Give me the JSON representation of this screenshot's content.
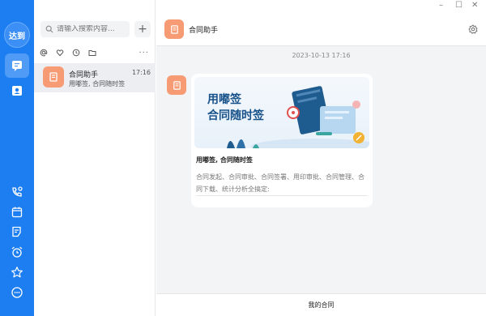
{
  "nav": {
    "avatar_label": "达到",
    "items": [
      {
        "icon": "chat-icon",
        "active": true
      },
      {
        "icon": "contacts-icon",
        "active": false
      }
    ],
    "bottom_items": [
      {
        "icon": "phone-icon"
      },
      {
        "icon": "calendar-icon"
      },
      {
        "icon": "notes-icon"
      },
      {
        "icon": "alarm-icon"
      },
      {
        "icon": "star-icon"
      },
      {
        "icon": "more-circle-icon"
      }
    ]
  },
  "list": {
    "search_placeholder": "请输入搜索内容...",
    "plus_label": "+",
    "filters": [
      "at-icon",
      "heart-icon",
      "clock-icon",
      "folder-icon"
    ],
    "more_label": "···",
    "conversations": [
      {
        "name": "合同助手",
        "time": "17:16",
        "preview": "用嘟签, 合同随时签"
      }
    ]
  },
  "chat": {
    "window_controls": [
      "–",
      "☐",
      "✕"
    ],
    "title": "合同助手",
    "timestamp": "2023-10-13 17:16",
    "card": {
      "banner_line1": "用嘟签",
      "banner_line2": "合同随时签",
      "title": "用嘟签, 合同随时签",
      "description": "合同发起、合同审批、合同签署、用印审批、合同管理、合同下载、统计分析全搞定:"
    },
    "bottom_button": "我的合同"
  },
  "colors": {
    "brand_blue": "#1d7ef2",
    "assistant_orange": "#f79b74"
  }
}
